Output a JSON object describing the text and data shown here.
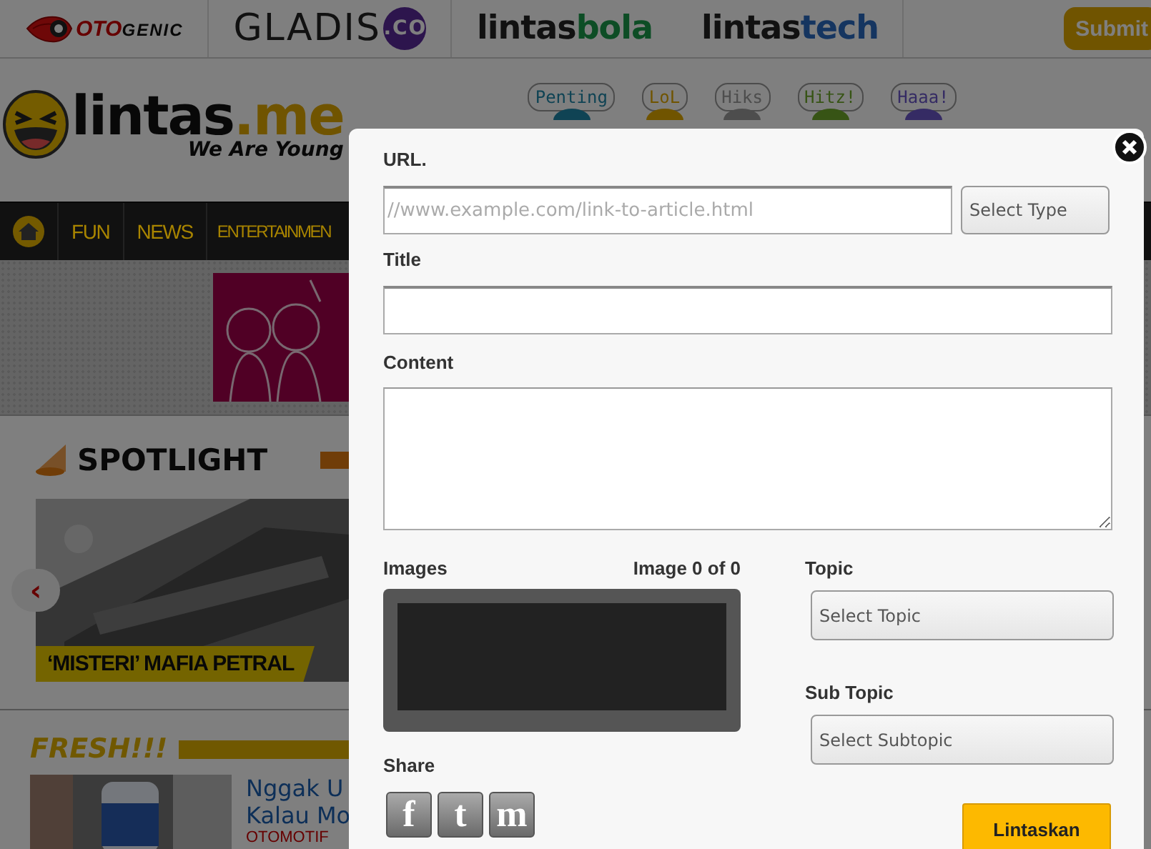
{
  "top_bar": {
    "sites": [
      {
        "kind": "otogenic",
        "parts": [
          "OTO",
          "GENIC"
        ]
      },
      {
        "kind": "gladis",
        "parts": [
          "GLADIS",
          ".CO"
        ]
      },
      {
        "kind": "lintasbola",
        "parts": [
          "lintas",
          "bola"
        ]
      },
      {
        "kind": "lintastech",
        "parts": [
          "lintas",
          "tech"
        ]
      }
    ],
    "submit": "Submit"
  },
  "masthead": {
    "logo_parts": [
      "lintas",
      ".me"
    ],
    "tagline": "We Are Young",
    "moods": [
      {
        "label": "Penting",
        "color": "#0f4354"
      },
      {
        "label": "LoL",
        "color": "#705400"
      },
      {
        "label": "Hiks",
        "color": "#4d4d4d"
      },
      {
        "label": "Hitz!",
        "color": "#375415"
      },
      {
        "label": "Haaa!",
        "color": "#352b64"
      }
    ]
  },
  "nav": {
    "items": [
      "FUN",
      "NEWS",
      "ENTERTAINMEN"
    ]
  },
  "spotlight": {
    "title": "SPOTLIGHT",
    "prev": "‹",
    "caption": "‘MISTERI’ MAFIA PETRAL"
  },
  "fresh": {
    "title": "FRESH!!!",
    "article_title_lines": [
      "Nggak U",
      "Kalau Mo"
    ],
    "category": "OTOMOTIF"
  },
  "modal": {
    "url": {
      "label": "URL.",
      "placeholder": "//www.example.com/link-to-article.html"
    },
    "type_select": {
      "placeholder": "Select Type"
    },
    "title": {
      "label": "Title"
    },
    "content": {
      "label": "Content"
    },
    "images": {
      "label": "Images",
      "counter": "Image 0 of 0"
    },
    "topic": {
      "label": "Topic",
      "placeholder": "Select Topic"
    },
    "subtopic": {
      "label": "Sub Topic",
      "placeholder": "Select Subtopic"
    },
    "share": {
      "label": "Share",
      "buttons": [
        "f",
        "t",
        "m"
      ]
    },
    "submit": "Lintaskan"
  }
}
